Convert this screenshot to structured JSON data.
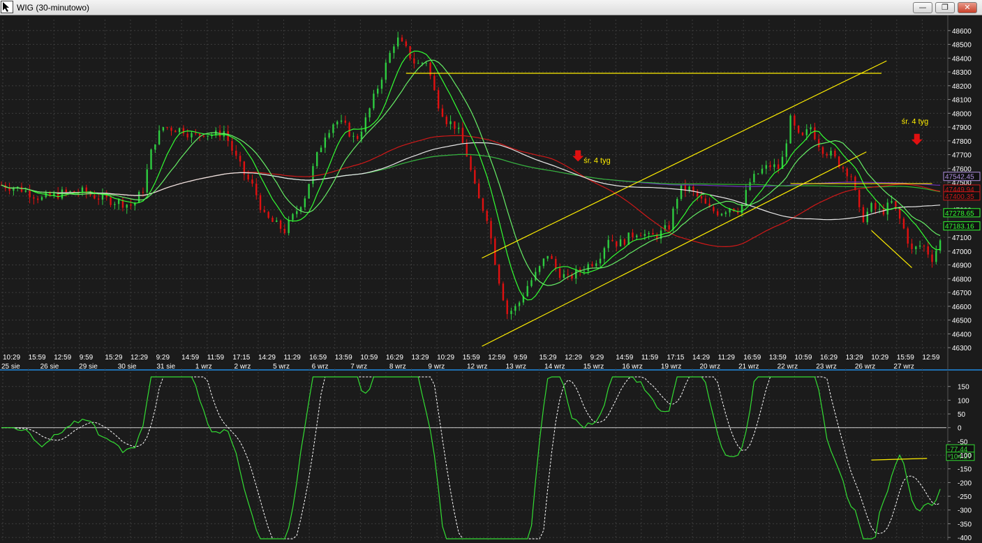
{
  "window": {
    "title": "WIG (30-minutowo)",
    "minimize_glyph": "—",
    "restore_glyph": "❐",
    "close_glyph": "✕",
    "app_icon": "cursor-arrow-icon"
  },
  "colors": {
    "background": "#1b1b1b",
    "grid": "#3c3c3c",
    "up_candle": "#2ecc40",
    "down_candle": "#e01010",
    "ma_fast": "#33ff33",
    "ma_fast2": "#66ee66",
    "ma_red": "#d01818",
    "ma_white": "#e8e8e8",
    "ma_purple": "#7030c0",
    "ma_green_slow": "#2fb82f",
    "trendline": "#ffee00",
    "separator": "#1f6fb0",
    "osc_line": "#33dd33",
    "osc_signal": "#ffffff"
  },
  "chart_data": [
    {
      "type": "candlestick",
      "title": "WIG (30-minutowo)",
      "ylim": [
        46250,
        48680
      ],
      "y_ticks": [
        46300,
        46400,
        46500,
        46600,
        46700,
        46800,
        46900,
        47000,
        47100,
        47200,
        47300,
        47400,
        47500,
        47600,
        47700,
        47800,
        47900,
        48000,
        48100,
        48200,
        48300,
        48400,
        48500,
        48600
      ],
      "time_labels": [
        "10:29",
        "15:59",
        "12:59",
        "9:59",
        "15:29",
        "12:29",
        "9:29",
        "14:59",
        "11:59",
        "17:15",
        "14:29",
        "11:29",
        "16:59",
        "13:59",
        "10:59",
        "16:29",
        "13:29",
        "10:29",
        "15:59",
        "12:59",
        "9:59",
        "15:29",
        "12:29",
        "9:29",
        "14:59",
        "11:59",
        "17:15",
        "14:29",
        "11:29",
        "16:59",
        "13:59",
        "10:59",
        "16:29",
        "13:29",
        "10:29",
        "15:59",
        "12:59"
      ],
      "date_labels": [
        "25 sie",
        "26 sie",
        "29 sie",
        "30 sie",
        "31 sie",
        "1 wrz",
        "2 wrz",
        "5 wrz",
        "6 wrz",
        "7 wrz",
        "8 wrz",
        "9 wrz",
        "12 wrz",
        "13 wrz",
        "14 wrz",
        "15 wrz",
        "16 wrz",
        "19 wrz",
        "20 wrz",
        "21 wrz",
        "22 wrz",
        "23 wrz",
        "26 wrz",
        "27 wrz"
      ],
      "close_path": [
        [
          0,
          47480
        ],
        [
          2,
          47450
        ],
        [
          4,
          47380
        ],
        [
          6,
          47420
        ],
        [
          8,
          47430
        ],
        [
          10,
          47380
        ],
        [
          12,
          47350
        ],
        [
          13,
          47330
        ],
        [
          14,
          47450
        ],
        [
          15,
          47780
        ],
        [
          16,
          47900
        ],
        [
          18,
          47880
        ],
        [
          19,
          47830
        ],
        [
          20,
          47860
        ],
        [
          21,
          47840
        ],
        [
          22,
          47870
        ],
        [
          23,
          47700
        ],
        [
          24,
          47560
        ],
        [
          25,
          47450
        ],
        [
          26,
          47250
        ],
        [
          27,
          47200
        ],
        [
          28,
          47150
        ],
        [
          29,
          47270
        ],
        [
          30,
          47400
        ],
        [
          31,
          47650
        ],
        [
          32,
          47850
        ],
        [
          33,
          47950
        ],
        [
          34,
          47900
        ],
        [
          35,
          47800
        ],
        [
          36,
          47950
        ],
        [
          37,
          48150
        ],
        [
          38,
          48350
        ],
        [
          39,
          48550
        ],
        [
          40,
          48460
        ],
        [
          41,
          48350
        ],
        [
          42,
          48380
        ],
        [
          43,
          48100
        ],
        [
          44,
          47950
        ],
        [
          45,
          47900
        ],
        [
          46,
          47700
        ],
        [
          47,
          47400
        ],
        [
          48,
          47250
        ],
        [
          49,
          46850
        ],
        [
          50,
          46550
        ],
        [
          51,
          46600
        ],
        [
          52,
          46750
        ],
        [
          53,
          46850
        ],
        [
          54,
          46980
        ],
        [
          55,
          46850
        ],
        [
          56,
          46800
        ],
        [
          57,
          46850
        ],
        [
          58,
          46900
        ],
        [
          59,
          46950
        ],
        [
          60,
          47100
        ],
        [
          61,
          47050
        ],
        [
          62,
          47100
        ],
        [
          63,
          47150
        ],
        [
          64,
          47100
        ],
        [
          65,
          47120
        ],
        [
          66,
          47180
        ],
        [
          67,
          47450
        ],
        [
          68,
          47450
        ],
        [
          69,
          47380
        ],
        [
          70,
          47300
        ],
        [
          71,
          47280
        ],
        [
          72,
          47320
        ],
        [
          73,
          47300
        ],
        [
          74,
          47500
        ],
        [
          75,
          47580
        ],
        [
          76,
          47620
        ],
        [
          77,
          47600
        ],
        [
          78,
          47950
        ],
        [
          79,
          47800
        ],
        [
          80,
          47900
        ],
        [
          81,
          47750
        ],
        [
          82,
          47700
        ],
        [
          83,
          47620
        ],
        [
          84,
          47550
        ],
        [
          85,
          47220
        ],
        [
          86,
          47320
        ],
        [
          87,
          47280
        ],
        [
          88,
          47350
        ],
        [
          89,
          47200
        ],
        [
          90,
          47000
        ],
        [
          91,
          47050
        ],
        [
          92,
          46950
        ],
        [
          93,
          47100
        ]
      ],
      "series": [
        {
          "name": "",
          "values": [
            47290,
            47285,
            47283,
            47280
          ]
        },
        {
          "name": "",
          "values": [
            47180,
            47175,
            47170,
            47168
          ]
        }
      ],
      "annotations": [
        {
          "text": "śr. 4 tyg",
          "near": "14 wrz"
        },
        {
          "text": "śr. 4 tyg",
          "near": "26 wrz"
        }
      ],
      "price_labels": [
        "47542.45",
        "47449.94",
        "47400.35",
        "47278.65",
        "47183.16"
      ]
    },
    {
      "type": "line",
      "ylim": [
        -410,
        190
      ],
      "y_ticks": [
        150,
        100,
        50,
        0,
        -50,
        -100,
        -150,
        -200,
        -250,
        -300,
        -350,
        -400
      ],
      "value_labels": [
        "-77.44",
        "-104.27"
      ]
    }
  ]
}
